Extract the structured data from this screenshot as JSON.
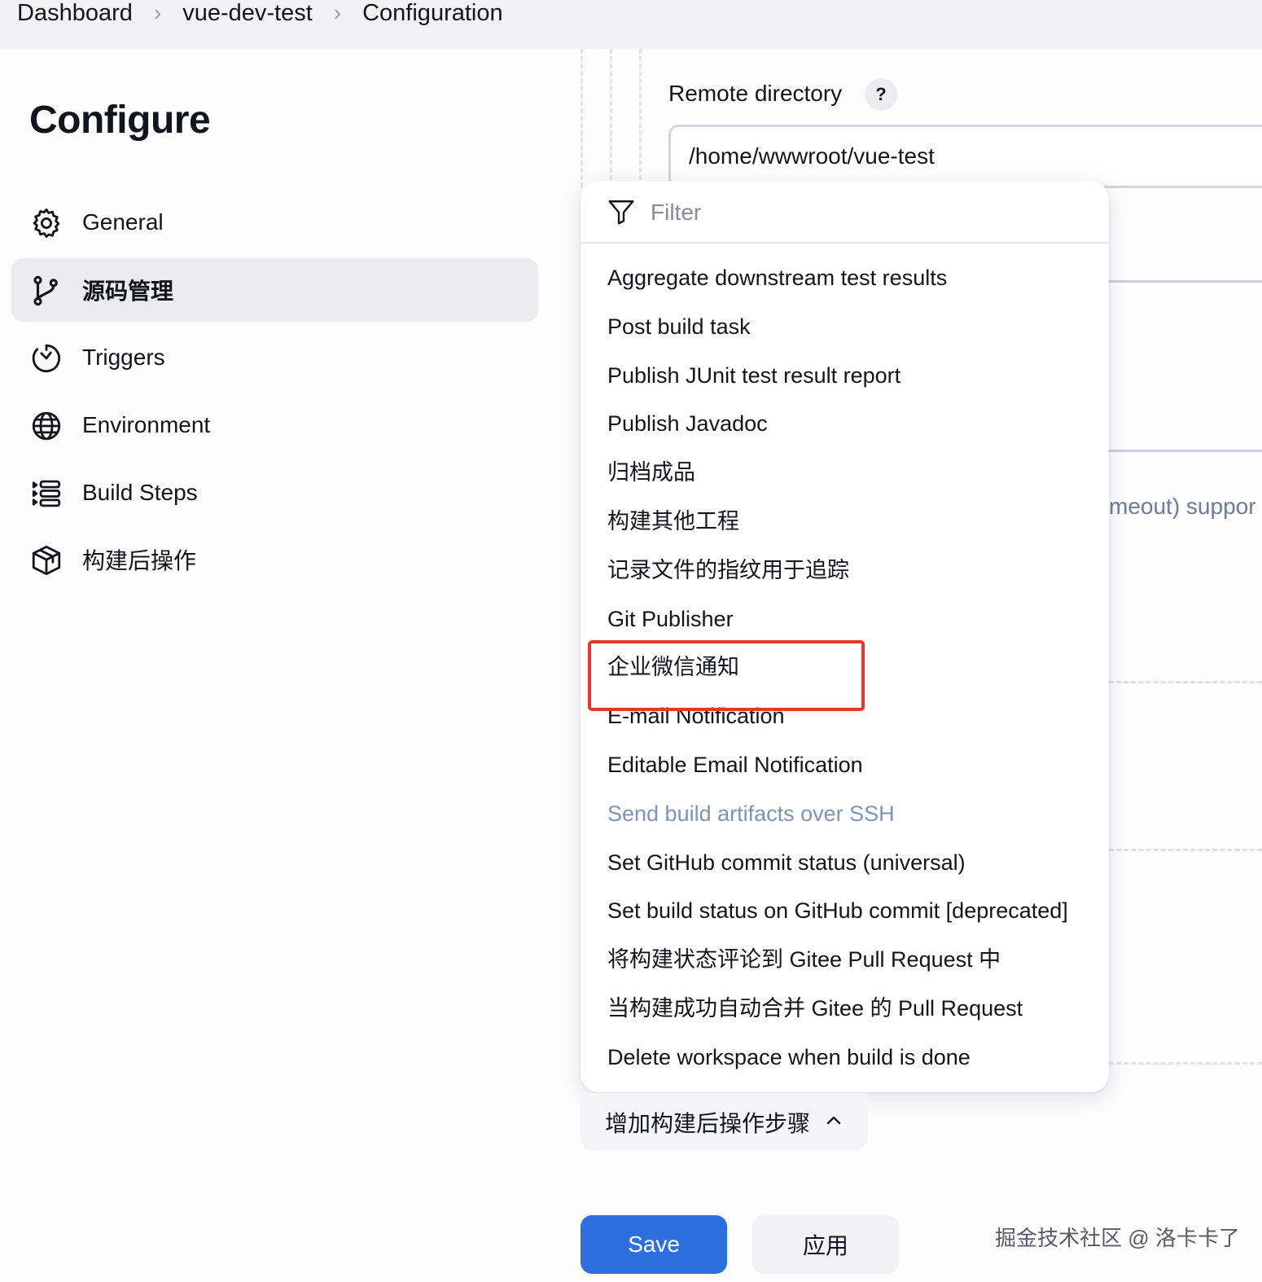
{
  "breadcrumb": {
    "items": [
      "Dashboard",
      "vue-dev-test",
      "Configuration"
    ],
    "separator": ">"
  },
  "page": {
    "title": "Configure"
  },
  "sidebar": {
    "items": [
      {
        "label": "General",
        "icon": "gear-icon",
        "active": false
      },
      {
        "label": "源码管理",
        "icon": "git-branch-icon",
        "active": true
      },
      {
        "label": "Triggers",
        "icon": "clock-icon",
        "active": false
      },
      {
        "label": "Environment",
        "icon": "globe-icon",
        "active": false
      },
      {
        "label": "Build Steps",
        "icon": "list-steps-icon",
        "active": false
      },
      {
        "label": "构建后操作",
        "icon": "package-icon",
        "active": false
      }
    ]
  },
  "remote_directory": {
    "label": "Remote directory",
    "help": "?",
    "value": "/home/wwwroot/vue-test"
  },
  "background_text": "meout) suppor",
  "dropdown": {
    "filter_placeholder": "Filter",
    "items": [
      {
        "label": "Aggregate downstream test results",
        "disabled": false
      },
      {
        "label": "Post build task",
        "disabled": false
      },
      {
        "label": "Publish JUnit test result report",
        "disabled": false
      },
      {
        "label": "Publish Javadoc",
        "disabled": false
      },
      {
        "label": "归档成品",
        "disabled": false
      },
      {
        "label": "构建其他工程",
        "disabled": false
      },
      {
        "label": "记录文件的指纹用于追踪",
        "disabled": false
      },
      {
        "label": "Git Publisher",
        "disabled": false
      },
      {
        "label": "企业微信通知",
        "disabled": false,
        "highlighted": true
      },
      {
        "label": "E-mail Notification",
        "disabled": false
      },
      {
        "label": "Editable Email Notification",
        "disabled": false
      },
      {
        "label": "Send build artifacts over SSH",
        "disabled": true
      },
      {
        "label": "Set GitHub commit status (universal)",
        "disabled": false
      },
      {
        "label": "Set build status on GitHub commit [deprecated]",
        "disabled": false
      },
      {
        "label": "将构建状态评论到 Gitee Pull Request 中",
        "disabled": false
      },
      {
        "label": "当构建成功自动合并 Gitee 的 Pull Request",
        "disabled": false
      },
      {
        "label": "Delete workspace when build is done",
        "disabled": false
      }
    ]
  },
  "add_post_build_step": {
    "label": "增加构建后操作步骤",
    "icon": "chevron-up-icon"
  },
  "actions": {
    "save_label": "Save",
    "apply_label": "应用"
  },
  "watermark": "掘金技术社区 @ 洛卡卡了",
  "colors": {
    "primary": "#2d6fdd",
    "highlight_border": "#e03a2e",
    "disabled_text": "#7f94b5",
    "active_nav_bg": "#ececef"
  }
}
